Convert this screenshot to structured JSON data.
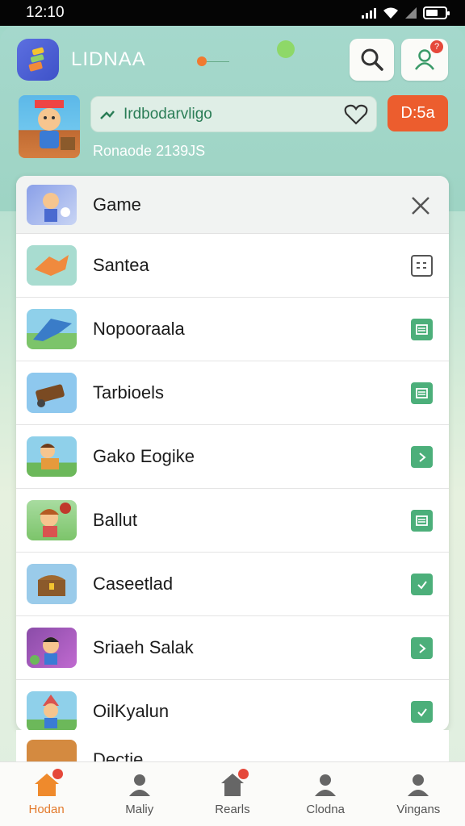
{
  "status_bar": {
    "time": "12:10"
  },
  "header": {
    "app_name": "LIDNAA",
    "search_pill_text": "Irdbodarvligo",
    "orange_button_label": "D:5a",
    "subtitle": "Ronaode 2139JS"
  },
  "list": {
    "header_label": "Game",
    "items": [
      {
        "label": "Santea",
        "label_color": "#1b1b1b",
        "action": "grid-icon"
      },
      {
        "label": "Nopooraala",
        "label_color": "#1b1b1b",
        "action": "list-icon"
      },
      {
        "label": "Tarbioels",
        "label_color": "#1b1b1b",
        "action": "list-icon"
      },
      {
        "label": "Gako Eogike",
        "label_color": "#1b1b1b",
        "action": "chevron-icon"
      },
      {
        "label": "Ballut",
        "label_color": "#1b1b1b",
        "action": "list-icon"
      },
      {
        "label": "Caseetlad",
        "label_color": "#1b1b1b",
        "action": "check-icon"
      },
      {
        "label": "Sriaeh Salak",
        "label_color": "#1b1b1b",
        "action": "chevron-icon"
      },
      {
        "label": "OilKyalun",
        "label_color": "#1b1b1b",
        "action": "check-icon"
      }
    ],
    "peek_label": "Dectie"
  },
  "bottom_nav": [
    {
      "label": "Hodan",
      "icon": "home-icon",
      "badge": true,
      "active": true
    },
    {
      "label": "Maliy",
      "icon": "person-icon",
      "badge": false,
      "active": false
    },
    {
      "label": "Rearls",
      "icon": "house-icon",
      "badge": true,
      "active": false
    },
    {
      "label": "Clodna",
      "icon": "person-icon",
      "badge": false,
      "active": false
    },
    {
      "label": "Vingans",
      "icon": "person-icon",
      "badge": false,
      "active": false
    }
  ],
  "colors": {
    "accent_green": "#4caf7a",
    "accent_orange": "#ec5d2e",
    "active_nav": "#e37a2c"
  }
}
